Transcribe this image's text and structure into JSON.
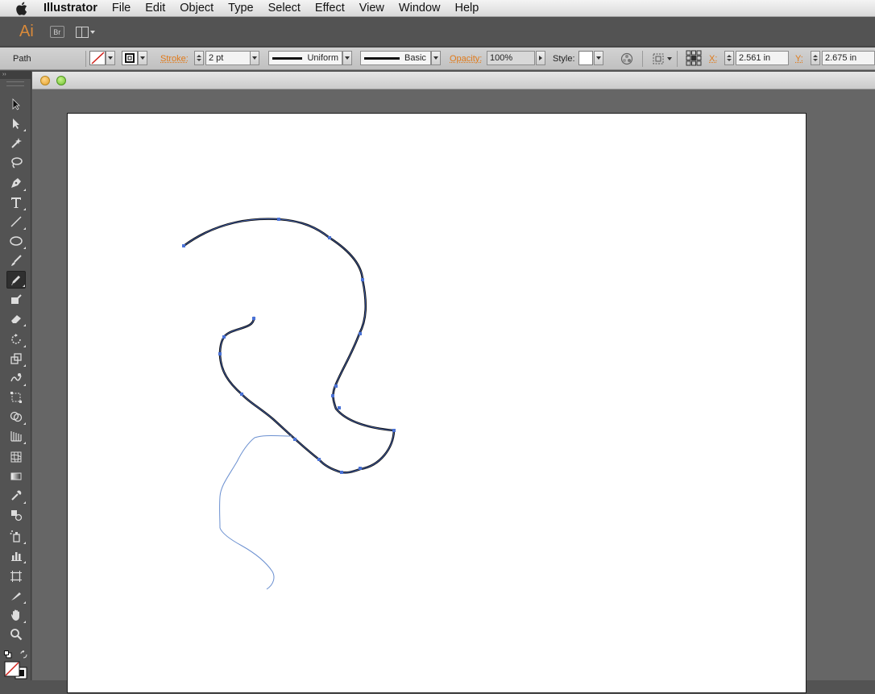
{
  "menubar": {
    "apple_icon": "apple-icon",
    "app_name": "Illustrator",
    "items": [
      "File",
      "Edit",
      "Object",
      "Type",
      "Select",
      "Effect",
      "View",
      "Window",
      "Help"
    ]
  },
  "appbar": {
    "logo": "Ai",
    "bridge_label": "Br",
    "arrange_icon": "arrange-documents-icon"
  },
  "control": {
    "selection_type": "Path",
    "stroke_label": "Stroke:",
    "stroke_weight": "2 pt",
    "variable_width": "Uniform",
    "brush": "Basic",
    "opacity_label": "Opacity:",
    "opacity": "100%",
    "style_label": "Style:",
    "x_label": "X:",
    "x_value": "2.561 in",
    "y_label": "Y:",
    "y_value": "2.675 in"
  },
  "tools": {
    "header": "››",
    "items": [
      "selection-tool",
      "direct-selection-tool",
      "magic-wand-tool",
      "lasso-tool",
      "pen-tool",
      "type-tool",
      "line-segment-tool",
      "ellipse-tool",
      "paintbrush-tool",
      "pencil-tool",
      "blob-brush-tool",
      "eraser-tool",
      "rotate-tool",
      "scale-tool",
      "warp-tool",
      "free-transform-tool",
      "shape-builder-tool",
      "perspective-grid-tool",
      "mesh-tool",
      "gradient-tool",
      "eyedropper-tool",
      "blend-tool",
      "symbol-sprayer-tool",
      "column-graph-tool",
      "artboard-tool",
      "slice-tool",
      "hand-tool",
      "zoom-tool"
    ],
    "active": "pencil-tool"
  },
  "colors": {
    "accent_orange": "#e07a1a",
    "path_stroke": "#111111",
    "selection_blue": "#4a72d6",
    "pencil_preview": "#6a8fd0",
    "pasteboard": "#666666",
    "ui_gray": "#535353"
  }
}
